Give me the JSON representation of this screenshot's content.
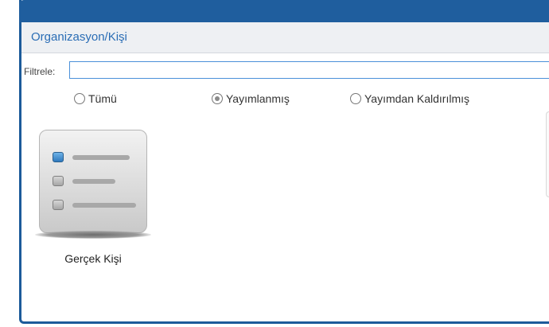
{
  "header": {
    "title": "Organizasyon/Kişi"
  },
  "filter": {
    "label": "Filtrele:",
    "value": "",
    "placeholder": ""
  },
  "status_filter": {
    "options": [
      {
        "label": "Tümü",
        "checked": false
      },
      {
        "label": "Yayımlanmış",
        "checked": true
      },
      {
        "label": "Yayımdan Kaldırılmış",
        "checked": false
      }
    ]
  },
  "tiles": [
    {
      "label": "Gerçek Kişi",
      "icon": "checklist-icon"
    }
  ],
  "colors": {
    "titlebar": "#1f5e9e",
    "header_bg": "#eef0f3",
    "accent_text": "#2a6db5",
    "input_border": "#4a90d9"
  }
}
